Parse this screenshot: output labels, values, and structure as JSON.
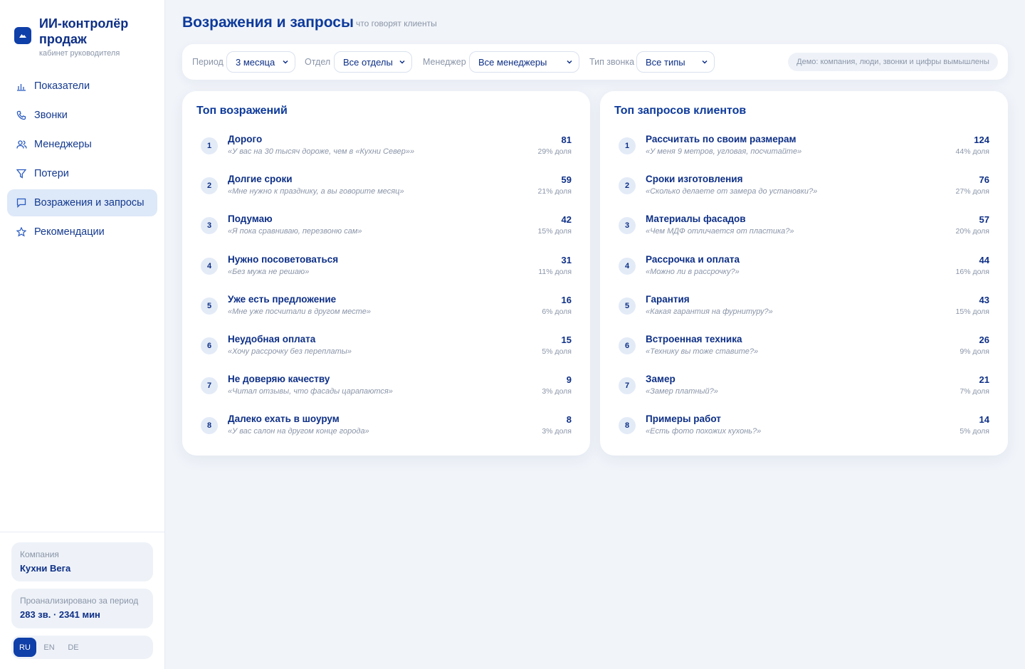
{
  "brand": {
    "title": "ИИ-контролёр продаж",
    "subtitle": "кабинет руководителя"
  },
  "nav": {
    "items": [
      {
        "label": "Показатели",
        "icon": "bar-chart-icon"
      },
      {
        "label": "Звонки",
        "icon": "phone-icon"
      },
      {
        "label": "Менеджеры",
        "icon": "users-icon"
      },
      {
        "label": "Потери",
        "icon": "filter-icon"
      },
      {
        "label": "Возражения и запросы",
        "icon": "message-icon",
        "active": true
      },
      {
        "label": "Рекомендации",
        "icon": "star-icon"
      }
    ]
  },
  "company": {
    "label": "Компания",
    "value": "Кухни Вега"
  },
  "analyzed": {
    "label": "Проанализировано за период",
    "value": "283 зв. · 2341 мин"
  },
  "languages": [
    "RU",
    "EN",
    "DE"
  ],
  "active_language": "RU",
  "header": {
    "title": "Возражения и запросы",
    "subtitle": "что говорят клиенты"
  },
  "filters": {
    "period": {
      "label": "Период",
      "value": "3 месяца"
    },
    "department": {
      "label": "Отдел",
      "value": "Все отделы"
    },
    "manager": {
      "label": "Менеджер",
      "value": "Все менеджеры"
    },
    "call_type": {
      "label": "Тип звонка",
      "value": "Все типы"
    },
    "demo_note": "Демо: компания, люди, звонки и цифры вымышлены"
  },
  "objections": {
    "title": "Топ возражений",
    "items": [
      {
        "rank": "1",
        "title": "Дорого",
        "quote": "«У вас на 30 тысяч дороже, чем в «Кухни Север»»",
        "count": "81",
        "share": "29% доля"
      },
      {
        "rank": "2",
        "title": "Долгие сроки",
        "quote": "«Мне нужно к празднику, а вы говорите месяц»",
        "count": "59",
        "share": "21% доля"
      },
      {
        "rank": "3",
        "title": "Подумаю",
        "quote": "«Я пока сравниваю, перезвоню сам»",
        "count": "42",
        "share": "15% доля"
      },
      {
        "rank": "4",
        "title": "Нужно посоветоваться",
        "quote": "«Без мужа не решаю»",
        "count": "31",
        "share": "11% доля"
      },
      {
        "rank": "5",
        "title": "Уже есть предложение",
        "quote": "«Мне уже посчитали в другом месте»",
        "count": "16",
        "share": "6% доля"
      },
      {
        "rank": "6",
        "title": "Неудобная оплата",
        "quote": "«Хочу рассрочку без переплаты»",
        "count": "15",
        "share": "5% доля"
      },
      {
        "rank": "7",
        "title": "Не доверяю качеству",
        "quote": "«Читал отзывы, что фасады царапаются»",
        "count": "9",
        "share": "3% доля"
      },
      {
        "rank": "8",
        "title": "Далеко ехать в шоурум",
        "quote": "«У вас салон на другом конце города»",
        "count": "8",
        "share": "3% доля"
      }
    ]
  },
  "requests": {
    "title": "Топ запросов клиентов",
    "items": [
      {
        "rank": "1",
        "title": "Рассчитать по своим размерам",
        "quote": "«У меня 9 метров, угловая, посчитайте»",
        "count": "124",
        "share": "44% доля"
      },
      {
        "rank": "2",
        "title": "Сроки изготовления",
        "quote": "«Сколько делаете от замера до установки?»",
        "count": "76",
        "share": "27% доля"
      },
      {
        "rank": "3",
        "title": "Материалы фасадов",
        "quote": "«Чем МДФ отличается от пластика?»",
        "count": "57",
        "share": "20% доля"
      },
      {
        "rank": "4",
        "title": "Рассрочка и оплата",
        "quote": "«Можно ли в рассрочку?»",
        "count": "44",
        "share": "16% доля"
      },
      {
        "rank": "5",
        "title": "Гарантия",
        "quote": "«Какая гарантия на фурнитуру?»",
        "count": "43",
        "share": "15% доля"
      },
      {
        "rank": "6",
        "title": "Встроенная техника",
        "quote": "«Технику вы тоже ставите?»",
        "count": "26",
        "share": "9% доля"
      },
      {
        "rank": "7",
        "title": "Замер",
        "quote": "«Замер платный?»",
        "count": "21",
        "share": "7% доля"
      },
      {
        "rank": "8",
        "title": "Примеры работ",
        "quote": "«Есть фото похожих кухонь?»",
        "count": "14",
        "share": "5% доля"
      }
    ]
  }
}
